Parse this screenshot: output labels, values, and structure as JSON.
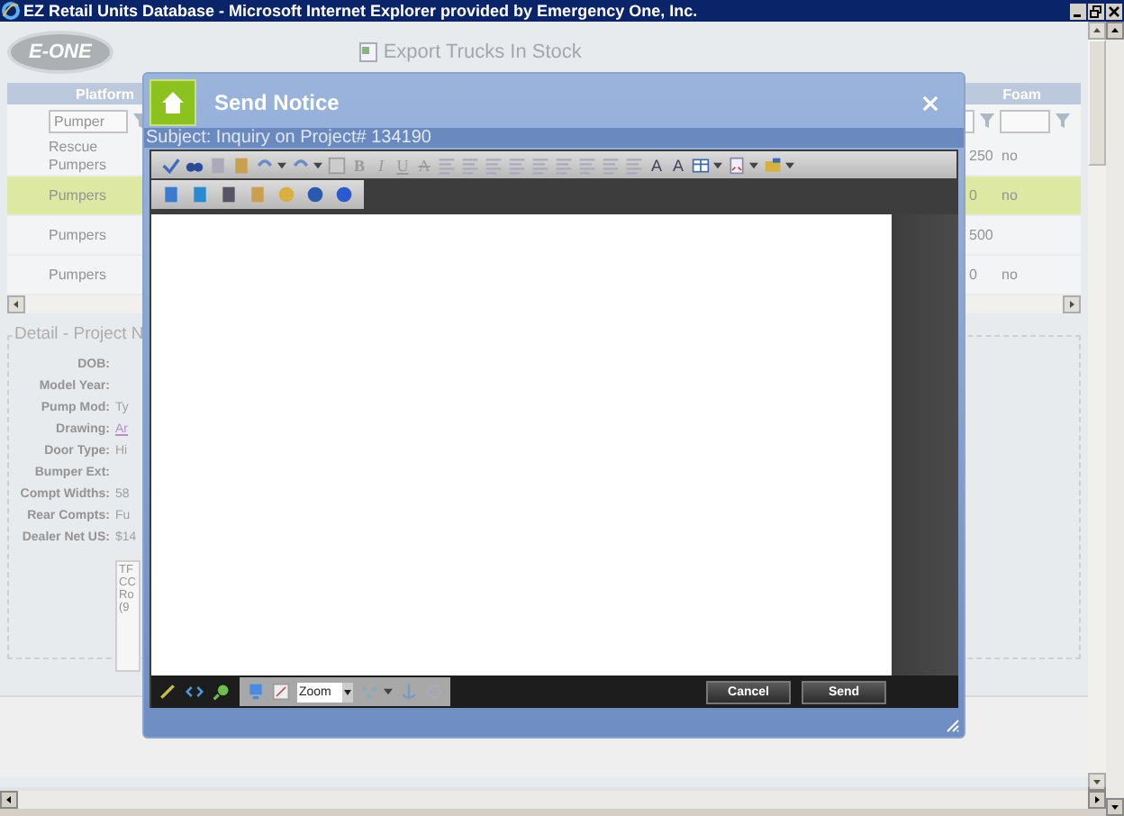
{
  "window": {
    "title": "EZ Retail Units Database - Microsoft Internet Explorer provided by Emergency One, Inc."
  },
  "header": {
    "logo": "E-ONE",
    "export_link": "Export Trucks In Stock"
  },
  "grid": {
    "columns": [
      {
        "label": "Platform",
        "filter": "Pumper"
      },
      {
        "label": "Foam"
      }
    ],
    "rows": [
      {
        "platform": "Rescue Pumpers",
        "column_2": "250",
        "foam": "no",
        "selected": false
      },
      {
        "platform": "Pumpers",
        "column_2": "0",
        "foam": "no",
        "selected": true
      },
      {
        "platform": "Pumpers",
        "column_2": "500",
        "selected": false
      },
      {
        "platform": "Pumpers",
        "column_2": "0",
        "foam": "no",
        "selected": false
      }
    ]
  },
  "detail": {
    "legend": "Detail - Project N",
    "fields": [
      {
        "label": "DOB:",
        "kind": "text"
      },
      {
        "label": "Model Year:",
        "kind": "text"
      },
      {
        "label": "Pump Mod:",
        "value": "Ty",
        "kind": "text"
      },
      {
        "label": "Drawing:",
        "value": "Ar",
        "kind": "link"
      },
      {
        "label": "Door Type:",
        "value": "Hi",
        "kind": "text"
      },
      {
        "label": "Bumper Ext:",
        "kind": "text"
      },
      {
        "label": "Compt Widths:",
        "value": "58",
        "kind": "text"
      },
      {
        "label": "Rear Compts:",
        "value": "Fu",
        "kind": "text"
      },
      {
        "label": "Dealer Net US:",
        "value": "$14",
        "kind": "text"
      }
    ],
    "notes": [
      "TF",
      "CC",
      "Ro",
      "(9"
    ]
  },
  "modal": {
    "title": "Send Notice",
    "subject": "Subject: Inquiry on Project# 134190",
    "format_glyphs": [
      "B",
      "I",
      "U",
      "A"
    ],
    "size_glyphs": [
      "A",
      "A"
    ],
    "zoom": "Zoom",
    "buttons": [
      "Cancel",
      "Send"
    ]
  }
}
